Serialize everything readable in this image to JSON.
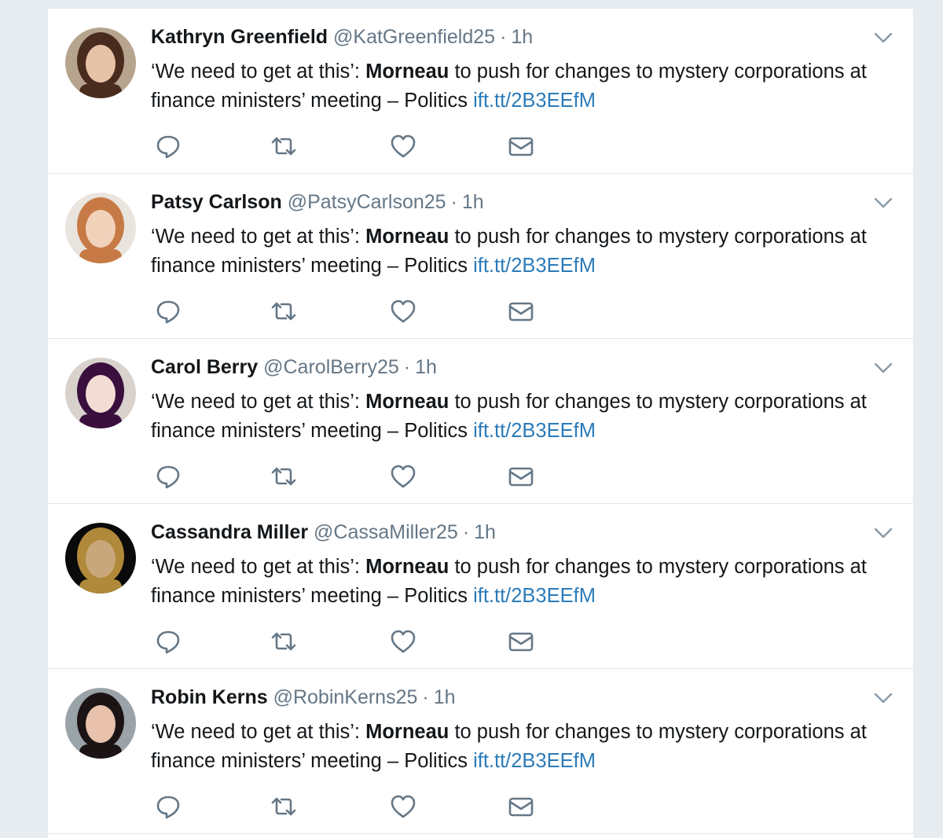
{
  "tweets": [
    {
      "fullname": "Kathryn Greenfield",
      "handle": "@KatGreenfield25",
      "time": "1h",
      "text_start": "‘We need to get at this’: ",
      "text_bold": "Morneau",
      "text_end": " to push for changes to mystery corporations at finance ministers’ meeting – Politics ",
      "link": "ift.tt/2B3EEfM",
      "avatar_bg": "#b7a48f",
      "avatar_hair": "#4a2c1e",
      "avatar_skin": "#e6c2a6"
    },
    {
      "fullname": "Patsy Carlson",
      "handle": "@PatsyCarlson25",
      "time": "1h",
      "text_start": "‘We need to get at this’: ",
      "text_bold": "Morneau",
      "text_end": " to push for changes to mystery corporations at finance ministers’ meeting – Politics ",
      "link": "ift.tt/2B3EEfM",
      "avatar_bg": "#e9e4de",
      "avatar_hair": "#c77a45",
      "avatar_skin": "#f1d2bb"
    },
    {
      "fullname": "Carol Berry",
      "handle": "@CarolBerry25",
      "time": "1h",
      "text_start": "‘We need to get at this’: ",
      "text_bold": "Morneau",
      "text_end": " to push for changes to mystery corporations at finance ministers’ meeting – Politics ",
      "link": "ift.tt/2B3EEfM",
      "avatar_bg": "#d8d1cc",
      "avatar_hair": "#3a0f3d",
      "avatar_skin": "#f3dcd3"
    },
    {
      "fullname": "Cassandra Miller",
      "handle": "@CassaMiller25",
      "time": "1h",
      "text_start": "‘We need to get at this’: ",
      "text_bold": "Morneau",
      "text_end": " to push for changes to mystery corporations at finance ministers’ meeting – Politics ",
      "link": "ift.tt/2B3EEfM",
      "avatar_bg": "#0a0a0a",
      "avatar_hair": "#b08a3a",
      "avatar_skin": "#c9a77c"
    },
    {
      "fullname": "Robin Kerns",
      "handle": "@RobinKerns25",
      "time": "1h",
      "text_start": "‘We need to get at this’: ",
      "text_bold": "Morneau",
      "text_end": " to push for changes to mystery corporations at finance ministers’ meeting – Politics ",
      "link": "ift.tt/2B3EEfM",
      "avatar_bg": "#9aa3a8",
      "avatar_hair": "#1c1414",
      "avatar_skin": "#e8c2ac"
    }
  ],
  "icons": {
    "reply": "reply-icon",
    "retweet": "retweet-icon",
    "like": "heart-icon",
    "dm": "envelope-icon",
    "menu": "chevron-down-icon"
  },
  "colors": {
    "link": "#2b7bb9",
    "muted": "#657786",
    "text": "#14171a",
    "icon": "#657786"
  }
}
